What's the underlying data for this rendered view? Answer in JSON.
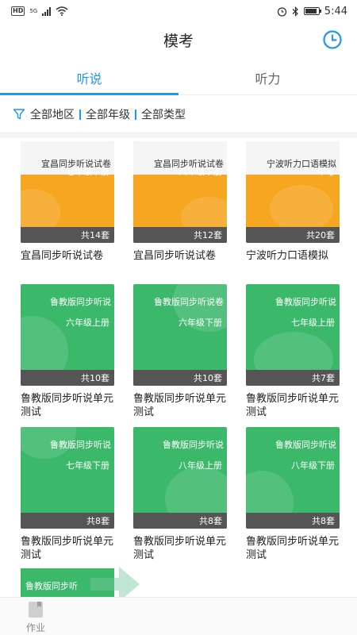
{
  "status_bar": {
    "network_label": "HD",
    "signal_label": "5G",
    "time": "5:44"
  },
  "header": {
    "title": "模考",
    "history_icon": "clock-icon"
  },
  "tabs": [
    {
      "label": "听说",
      "active": true
    },
    {
      "label": "听力",
      "active": false
    }
  ],
  "filters": {
    "icon": "filter-icon",
    "items": [
      "全部地区",
      "全部年级",
      "全部类型"
    ]
  },
  "papers": [
    {
      "cover_title": "宜昌同步听说试卷",
      "grade": "七年级下册",
      "count": "共14套",
      "name": "宜昌同步听说试卷",
      "color": "yellow"
    },
    {
      "cover_title": "宜昌同步听说试卷",
      "grade": "八年级下册",
      "count": "共12套",
      "name": "宜昌同步听说试卷",
      "color": "yellow"
    },
    {
      "cover_title": "宁波听力口语模拟",
      "grade": "中考",
      "count": "共20套",
      "name": "宁波听力口语模拟",
      "color": "yellow"
    },
    {
      "cover_title": "鲁教版同步听说",
      "grade": "六年级上册",
      "count": "共10套",
      "name": "鲁教版同步听说单元测试",
      "color": "green"
    },
    {
      "cover_title": "鲁教版同步听说卷",
      "grade": "六年级下册",
      "count": "共10套",
      "name": "鲁教版同步听说单元测试",
      "color": "green"
    },
    {
      "cover_title": "鲁教版同步听说",
      "grade": "七年级上册",
      "count": "共7套",
      "name": "鲁教版同步听说单元测试",
      "color": "green"
    },
    {
      "cover_title": "鲁教版同步听说",
      "grade": "七年级下册",
      "count": "共8套",
      "name": "鲁教版同步听说单元测试",
      "color": "green"
    },
    {
      "cover_title": "鲁教版同步听说",
      "grade": "八年级上册",
      "count": "共8套",
      "name": "鲁教版同步听说单元测试",
      "color": "green"
    },
    {
      "cover_title": "鲁教版同步听说",
      "grade": "八年级下册",
      "count": "共8套",
      "name": "鲁教版同步听说单元测试",
      "color": "green"
    }
  ],
  "peek_card": {
    "cover_title": "鲁教版同步听"
  },
  "bottom_nav": [
    {
      "label": "作业",
      "icon": "homework-icon"
    }
  ],
  "colors": {
    "accent": "#2196f3",
    "yellow_cover": "#f6a620",
    "green_cover": "#3cb86b",
    "count_bar": "#555555"
  }
}
